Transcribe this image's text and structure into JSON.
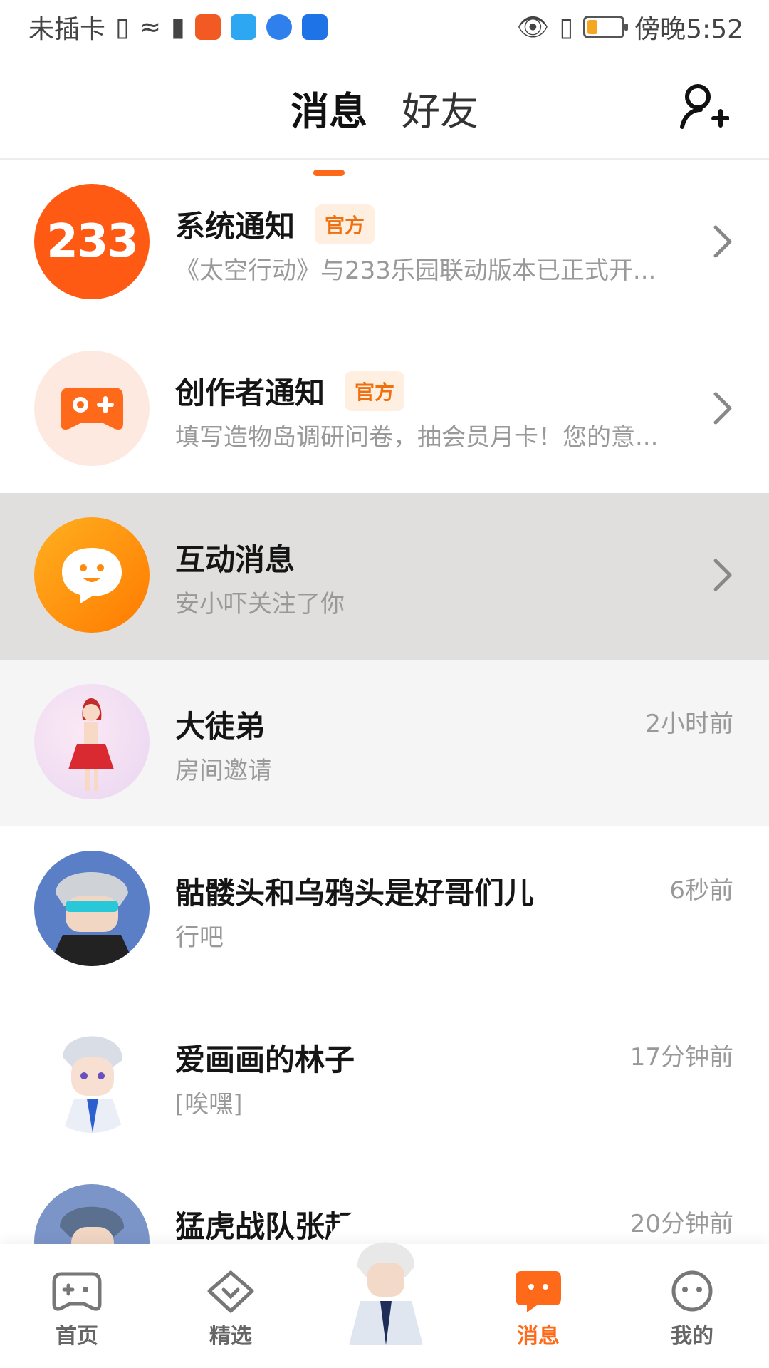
{
  "status_bar": {
    "carrier": "未插卡",
    "time": "傍晚5:52"
  },
  "header": {
    "tabs": [
      "消息",
      "好友"
    ],
    "active_tab": "消息"
  },
  "messages": [
    {
      "title": "系统通知",
      "badge": "官方",
      "subtitle": "《太空行动》与233乐园联动版本已正式开...",
      "avatar_text": "233",
      "avatar_color": "#ff5a14"
    },
    {
      "title": "创作者通知",
      "badge": "官方",
      "subtitle": "填写造物岛调研问卷，抽会员月卡！您的意...",
      "avatar_color": "#fde9df"
    },
    {
      "title": "互动消息",
      "subtitle": "安小吓关注了你",
      "avatar_color": "#ff8a0c"
    },
    {
      "title": "大徒弟",
      "subtitle": "房间邀请",
      "time": "2小时前"
    },
    {
      "title": "骷髅头和乌鸦头是好哥们儿",
      "subtitle": "行吧",
      "time": "6秒前"
    },
    {
      "title": "爱画画的林子",
      "subtitle": "[唉嘿]",
      "time": "17分钟前"
    },
    {
      "title": "猛虎战队张起灵",
      "subtitle": "",
      "time": "20分钟前"
    }
  ],
  "bottom_nav": [
    {
      "label": "首页"
    },
    {
      "label": "精选"
    },
    {
      "label": "消息"
    },
    {
      "label": "我的"
    }
  ],
  "colors": {
    "accent": "#ff6a1a",
    "badge_bg": "#ffefe0",
    "highlight_row": "#e0dfdd"
  }
}
